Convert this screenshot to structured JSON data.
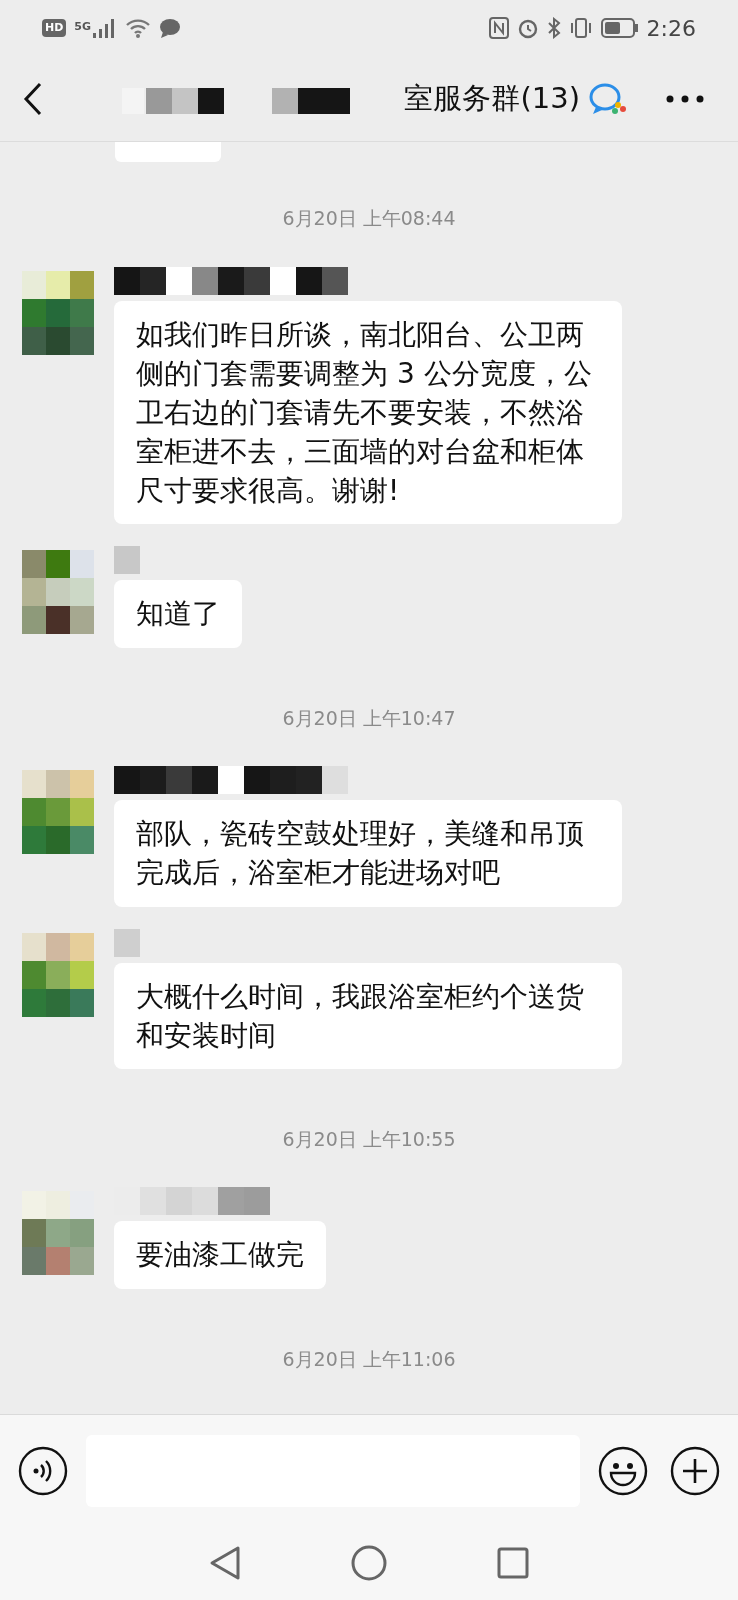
{
  "status_bar": {
    "hd": "HD",
    "network": "5G",
    "time": "2:26"
  },
  "header": {
    "title": "室服务群(13)"
  },
  "messages": [
    {
      "kind": "fragment"
    },
    {
      "kind": "timestamp",
      "text": "6月20日 上午08:44"
    },
    {
      "kind": "message",
      "text": "如我们昨日所谈，南北阳台、公卫两侧的门套需要调整为 3 公分宽度，公卫右边的门套请先不要安装，不然浴室柜进不去，三面墙的对台盆和柜体尺寸要求很高。谢谢!"
    },
    {
      "kind": "message",
      "text": "知道了"
    },
    {
      "kind": "timestamp",
      "text": "6月20日 上午10:47"
    },
    {
      "kind": "message",
      "text": "部队，瓷砖空鼓处理好，美缝和吊顶完成后，浴室柜才能进场对吧"
    },
    {
      "kind": "message",
      "text": "大概什么时间，我跟浴室柜约个送货和安装时间"
    },
    {
      "kind": "timestamp",
      "text": "6月20日 上午10:55"
    },
    {
      "kind": "message",
      "text": "要油漆工做完"
    },
    {
      "kind": "timestamp",
      "text": "6月20日 上午11:06"
    }
  ]
}
